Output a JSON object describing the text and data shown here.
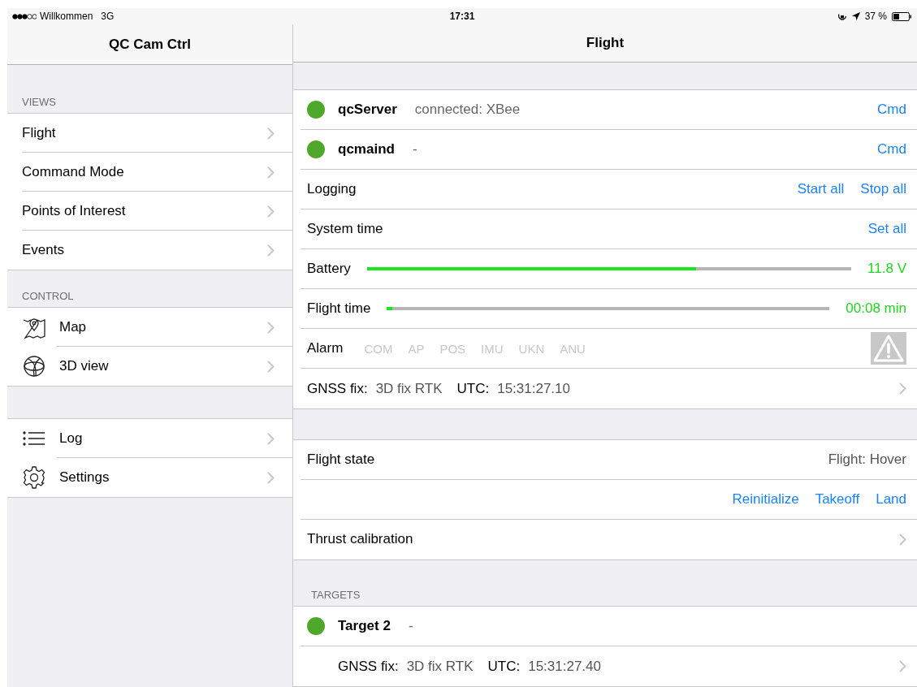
{
  "status_bar": {
    "carrier": "Willkommen",
    "network": "3G",
    "time": "17:31",
    "battery_text": "37 %"
  },
  "sidebar": {
    "title": "QC Cam Ctrl",
    "sections": [
      {
        "header": "VIEWS",
        "items": [
          {
            "label": "Flight"
          },
          {
            "label": "Command Mode"
          },
          {
            "label": "Points of Interest"
          },
          {
            "label": "Events"
          }
        ]
      },
      {
        "header": "CONTROL",
        "items": [
          {
            "label": "Map"
          },
          {
            "label": "3D view"
          }
        ]
      },
      {
        "items": [
          {
            "label": "Log"
          },
          {
            "label": "Settings"
          }
        ]
      }
    ]
  },
  "detail": {
    "title": "Flight",
    "sections": [
      {
        "rows": [
          {
            "kind": "status",
            "name": "qcServer",
            "info": "connected: XBee",
            "color": "#4fa82a",
            "actions": [
              "Cmd"
            ]
          },
          {
            "kind": "status",
            "name": "qcmaind",
            "info": "-",
            "color": "#4fa82a",
            "actions": [
              "Cmd"
            ]
          },
          {
            "kind": "actions",
            "label": "Logging",
            "actions": [
              "Start all",
              "Stop all"
            ]
          },
          {
            "kind": "actions",
            "label": "System time",
            "actions": [
              "Set all"
            ]
          },
          {
            "kind": "meter",
            "label": "Battery",
            "level": 0.68,
            "reading": "11.8 V"
          },
          {
            "kind": "meter",
            "label": "Flight time",
            "level": 0.012,
            "reading": "00:08 min"
          },
          {
            "kind": "alarm",
            "label": "Alarm",
            "flags": [
              {
                "label": "COM",
                "active": false
              },
              {
                "label": "AP",
                "active": false
              },
              {
                "label": "POS",
                "active": false
              },
              {
                "label": "IMU",
                "active": false
              },
              {
                "label": "UKN",
                "active": false
              },
              {
                "label": "ANU",
                "active": false
              }
            ]
          },
          {
            "kind": "gnss",
            "fix_label": "GNSS fix:",
            "fix": "3D fix RTK",
            "utc_label": "UTC:",
            "utc": "15:31:27.10"
          }
        ]
      },
      {
        "rows": [
          {
            "kind": "value",
            "label": "Flight state",
            "value": "Flight: Hover"
          },
          {
            "kind": "actions",
            "actions": [
              "Reinitialize",
              "Takeoff",
              "Land"
            ]
          },
          {
            "kind": "link",
            "label": "Thrust calibration"
          }
        ]
      },
      {
        "header": "TARGETS",
        "rows": [
          {
            "kind": "status",
            "name": "Target 2",
            "info": "-",
            "color": "#4fa82a"
          },
          {
            "kind": "gnss",
            "indent": true,
            "fix_label": "GNSS fix:",
            "fix": "3D fix RTK",
            "utc_label": "UTC:",
            "utc": "15:31:27.40"
          }
        ]
      }
    ]
  }
}
